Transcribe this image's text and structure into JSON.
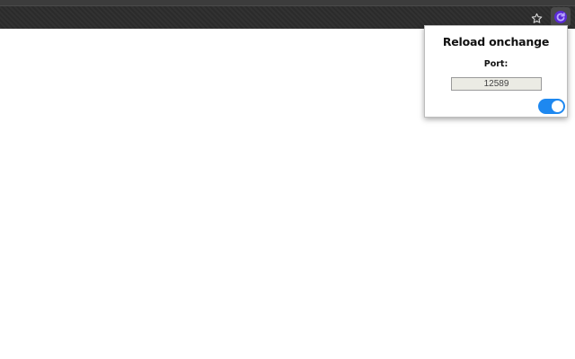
{
  "popup": {
    "title": "Reload onchange",
    "port_label": "Port:",
    "port_value": "12589",
    "toggle_on": true
  },
  "icons": {
    "bookmark": "star-icon",
    "extension": "reload-extension-icon"
  },
  "colors": {
    "toolbar": "#2b2b2b",
    "toggle_on": "#1e88f0",
    "extension_accent": "#6a35e0"
  }
}
